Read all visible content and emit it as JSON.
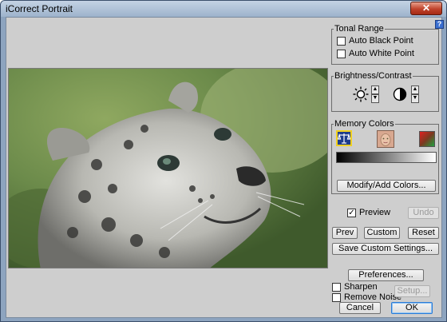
{
  "window": {
    "title": "iCorrect Portrait",
    "close_glyph": "✕"
  },
  "help": {
    "glyph": "?"
  },
  "tonal_range": {
    "legend": "Tonal Range",
    "auto_black_point": {
      "label": "Auto Black Point",
      "checked": false
    },
    "auto_white_point": {
      "label": "Auto White Point",
      "checked": false
    }
  },
  "brightness_contrast": {
    "legend": "Brightness/Contrast",
    "brightness_icon": "sun-icon",
    "contrast_icon": "contrast-icon",
    "up_glyph": "▲",
    "down_glyph": "▼"
  },
  "memory_colors": {
    "legend": "Memory Colors",
    "swatches": [
      "scales-icon",
      "skin-face-icon",
      "color-gradient-icon"
    ],
    "modify_button": "Modify/Add Colors..."
  },
  "preview": {
    "label": "Preview",
    "checked": true,
    "check_glyph": "✓"
  },
  "buttons": {
    "undo": "Undo",
    "prev": "Prev",
    "custom": "Custom",
    "reset": "Reset",
    "save_custom": "Save Custom Settings...",
    "preferences": "Preferences...",
    "setup": "Setup...",
    "cancel": "Cancel",
    "ok": "OK"
  },
  "sharpen": {
    "label": "Sharpen",
    "checked": false
  },
  "remove_noise": {
    "label": "Remove Noise",
    "checked": false
  },
  "colors": {
    "accent_blue": "#2a7bd6",
    "panel_gray": "#cecece"
  }
}
